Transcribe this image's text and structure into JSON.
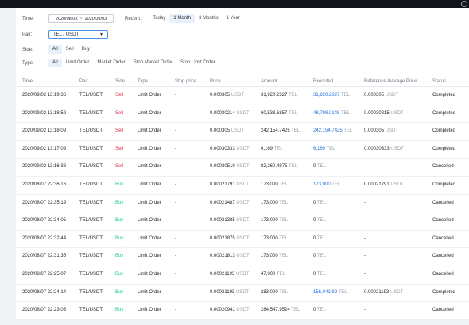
{
  "filters": {
    "time_label": "Time:",
    "date_start": "2020/08/03",
    "date_sep": "~",
    "date_end": "2020/09/03",
    "recent_label": "Recent :",
    "recent_tabs": [
      "Today",
      "1 Month",
      "3 Months",
      "1 Year"
    ],
    "recent_active": "1 Month",
    "pair_label": "Pair:",
    "pair_value": "TEL / USDT",
    "side_label": "Side:",
    "side_tabs": [
      "All",
      "Sell",
      "Buy"
    ],
    "side_active": "All",
    "type_label": "Type:",
    "type_tabs": [
      "All",
      "Limit Order",
      "Market Order",
      "Stop Market Order",
      "Stop Limit Order"
    ],
    "type_active": "All"
  },
  "table": {
    "headers": [
      "Time",
      "Pair",
      "Side",
      "Type",
      "Stop price",
      "Price",
      "Amount",
      "Executed",
      "Reference Average Price",
      "Status"
    ],
    "rows": [
      {
        "time": "2020/09/02 13:19:36",
        "pair": "TEL/USDT",
        "side": "Sell",
        "type": "Limit Order",
        "stop": "-",
        "price": "0.000305",
        "price_unit": "USDT",
        "amount": "31,920.2327",
        "amount_unit": "TEL",
        "executed": "31,920.2327",
        "executed_unit": "TEL",
        "ref": "0.000305",
        "ref_unit": "USDT",
        "status": "Completed"
      },
      {
        "time": "2020/09/02 13:18:59",
        "pair": "TEL/USDT",
        "side": "Sell",
        "type": "Limit Order",
        "stop": "-",
        "price": "0.00030214",
        "price_unit": "USDT",
        "amount": "60,538.6857",
        "amount_unit": "TEL",
        "executed": "48,798.0148",
        "executed_unit": "TEL",
        "ref": "0.00030215",
        "ref_unit": "USDT",
        "status": "Completed"
      },
      {
        "time": "2020/09/02 13:18:09",
        "pair": "TEL/USDT",
        "side": "Sell",
        "type": "Limit Order",
        "stop": "-",
        "price": "0.000305",
        "price_unit": "USDT",
        "amount": "242,154.7425",
        "amount_unit": "TEL",
        "executed": "242,154.7425",
        "executed_unit": "TEL",
        "ref": "0.000305",
        "ref_unit": "USDT",
        "status": "Completed"
      },
      {
        "time": "2020/09/02 13:17:09",
        "pair": "TEL/USDT",
        "side": "Sell",
        "type": "Limit Order",
        "stop": "-",
        "price": "0.00030333",
        "price_unit": "USDT",
        "amount": "6,169",
        "amount_unit": "TEL",
        "executed": "6,169",
        "executed_unit": "TEL",
        "ref": "0.00030333",
        "ref_unit": "USDT",
        "status": "Completed"
      },
      {
        "time": "2020/09/02 13:16:38",
        "pair": "TEL/USDT",
        "side": "Sell",
        "type": "Limit Order",
        "stop": "-",
        "price": "0.00030519",
        "price_unit": "USDT",
        "amount": "82,260.4975",
        "amount_unit": "TEL",
        "executed": "0",
        "executed_unit": "TEL",
        "ref": "-",
        "ref_unit": "",
        "status": "Cancelled"
      },
      {
        "time": "2020/08/07 22:36:16",
        "pair": "TEL/USDT",
        "side": "Buy",
        "type": "Limit Order",
        "stop": "-",
        "price": "0.00021791",
        "price_unit": "USDT",
        "amount": "173,000",
        "amount_unit": "TEL",
        "executed": "173,000",
        "executed_unit": "TEL",
        "ref": "0.00021791",
        "ref_unit": "USDT",
        "status": "Completed"
      },
      {
        "time": "2020/08/07 22:35:19",
        "pair": "TEL/USDT",
        "side": "Buy",
        "type": "Limit Order",
        "stop": "-",
        "price": "0.00021487",
        "price_unit": "USDT",
        "amount": "173,000",
        "amount_unit": "TEL",
        "executed": "0",
        "executed_unit": "TEL",
        "ref": "-",
        "ref_unit": "",
        "status": "Cancelled"
      },
      {
        "time": "2020/08/07 22:34:05",
        "pair": "TEL/USDT",
        "side": "Buy",
        "type": "Limit Order",
        "stop": "-",
        "price": "0.00021385",
        "price_unit": "USDT",
        "amount": "173,000",
        "amount_unit": "TEL",
        "executed": "0",
        "executed_unit": "TEL",
        "ref": "-",
        "ref_unit": "",
        "status": "Cancelled"
      },
      {
        "time": "2020/08/07 22:32:44",
        "pair": "TEL/USDT",
        "side": "Buy",
        "type": "Limit Order",
        "stop": "-",
        "price": "0.00021875",
        "price_unit": "USDT",
        "amount": "173,000",
        "amount_unit": "TEL",
        "executed": "0",
        "executed_unit": "TEL",
        "ref": "-",
        "ref_unit": "",
        "status": "Cancelled"
      },
      {
        "time": "2020/08/07 22:31:35",
        "pair": "TEL/USDT",
        "side": "Buy",
        "type": "Limit Order",
        "stop": "-",
        "price": "0.00021813",
        "price_unit": "USDT",
        "amount": "173,000",
        "amount_unit": "TEL",
        "executed": "0",
        "executed_unit": "TEL",
        "ref": "-",
        "ref_unit": "",
        "status": "Cancelled"
      },
      {
        "time": "2020/08/07 22:25:07",
        "pair": "TEL/USDT",
        "side": "Buy",
        "type": "Limit Order",
        "stop": "-",
        "price": "0.00021193",
        "price_unit": "USDT",
        "amount": "47,000",
        "amount_unit": "TEL",
        "executed": "0",
        "executed_unit": "TEL",
        "ref": "-",
        "ref_unit": "",
        "status": "Cancelled"
      },
      {
        "time": "2020/08/07 22:24:14",
        "pair": "TEL/USDT",
        "side": "Buy",
        "type": "Limit Order",
        "stop": "-",
        "price": "0.00021193",
        "price_unit": "USDT",
        "amount": "283,000",
        "amount_unit": "TEL",
        "executed": "156,041.99",
        "executed_unit": "TEL",
        "ref": "0.00021193",
        "ref_unit": "USDT",
        "status": "Completed"
      },
      {
        "time": "2020/08/07 22:23:03",
        "pair": "TEL/USDT",
        "side": "Buy",
        "type": "Limit Order",
        "stop": "-",
        "price": "0.00020941",
        "price_unit": "USDT",
        "amount": "284,547.9524",
        "amount_unit": "TEL",
        "executed": "0",
        "executed_unit": "TEL",
        "ref": "-",
        "ref_unit": "",
        "status": "Cancelled"
      }
    ]
  },
  "colors": {
    "sell": "#e0294a",
    "buy": "#0ecb81",
    "link": "#1e6fd9",
    "active_tab_bg": "#e8f0fb",
    "topbar": "#12161c"
  },
  "icons": {
    "caret": "chevron-down-icon",
    "top_right": "user-icon"
  }
}
